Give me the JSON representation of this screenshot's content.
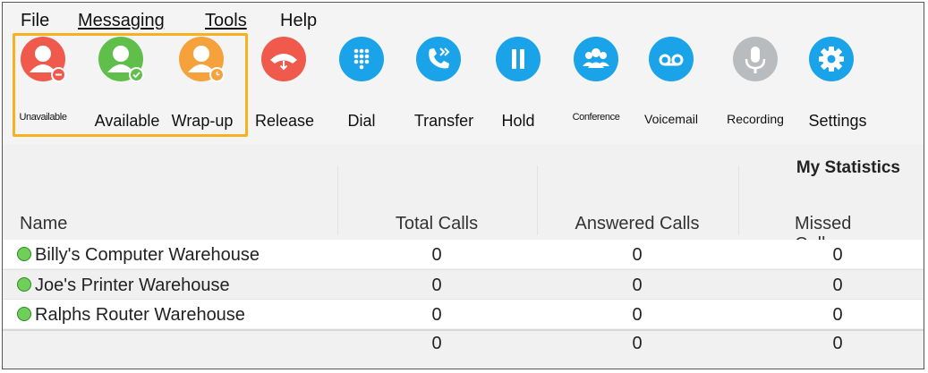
{
  "menu": {
    "file": "File",
    "messaging": "Messaging",
    "tools": "Tools",
    "help": "Help"
  },
  "toolbar": {
    "unavailable": {
      "label": "Unavailable",
      "color": "#ef5a4c",
      "icon": "user-icon",
      "badge": "minus-icon"
    },
    "available": {
      "label": "Available",
      "color": "#5fbf4a",
      "icon": "user-icon",
      "badge": "check-icon"
    },
    "wrapup": {
      "label": "Wrap-up",
      "color": "#f5a23c",
      "icon": "user-icon",
      "badge": "clock-icon"
    },
    "release": {
      "label": "Release",
      "color": "#ef5a4c",
      "icon": "hangup-icon"
    },
    "dial": {
      "label": "Dial",
      "color": "#1aa3e8",
      "icon": "dialpad-icon"
    },
    "transfer": {
      "label": "Transfer",
      "color": "#1aa3e8",
      "icon": "phone-transfer-icon"
    },
    "hold": {
      "label": "Hold",
      "color": "#1aa3e8",
      "icon": "pause-icon"
    },
    "conference": {
      "label": "Conference",
      "color": "#1aa3e8",
      "icon": "group-icon"
    },
    "voicemail": {
      "label": "Voicemail",
      "color": "#1aa3e8",
      "icon": "voicemail-icon"
    },
    "recording": {
      "label": "Recording",
      "color": "#b9bcbf",
      "icon": "microphone-icon"
    },
    "settings": {
      "label": "Settings",
      "color": "#1aa3e8",
      "icon": "gear-icon"
    }
  },
  "table": {
    "group_title": "My Statistics",
    "headers": {
      "name": "Name",
      "total": "Total Calls",
      "answered": "Answered Calls",
      "missed": "Missed Calls"
    },
    "rows": [
      {
        "name": "Billy's Computer Warehouse",
        "total": "0",
        "answered": "0",
        "missed": "0"
      },
      {
        "name": "Joe's Printer Warehouse",
        "total": "0",
        "answered": "0",
        "missed": "0"
      },
      {
        "name": "Ralphs Router Warehouse",
        "total": "0",
        "answered": "0",
        "missed": "0"
      }
    ],
    "totals": {
      "total": "0",
      "answered": "0",
      "missed": "0"
    },
    "status_color": "#6fcf5a"
  }
}
